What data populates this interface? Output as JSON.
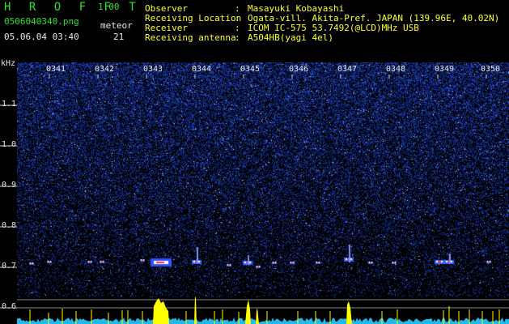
{
  "header": {
    "app_name": "H R O F F T",
    "version": "1.00",
    "filename": "0506040340.png",
    "datetime": "05.06.04 03:40",
    "meteor_label": "meteor",
    "meteor_count": "21"
  },
  "info": [
    {
      "label": "Observer",
      "value": "Masayuki Kobayashi"
    },
    {
      "label": "Receiving Location",
      "value": "Ogata-vill. Akita-Pref. JAPAN (139.96E, 40.02N)"
    },
    {
      "label": "Receiver",
      "value": "ICOM IC-575 53.7492(@LCD)MHz USB"
    },
    {
      "label": "Receiving antenna",
      "value": "A504HB(yagi 4el)"
    }
  ],
  "separator": ":",
  "axis": {
    "y_unit": "kHz",
    "y_ticks": [
      "1.1",
      "1.0",
      "0.9",
      "0.8",
      "0.7",
      "0.6"
    ],
    "x_ticks": [
      "0341",
      "0342",
      "0343",
      "0344",
      "0345",
      "0346",
      "0347",
      "0348",
      "0349",
      "0350"
    ]
  },
  "colors": {
    "title": "#2be02b",
    "info_text": "#ffff33",
    "signal_profile": "#ffff00",
    "noise_floor": "#33ccff",
    "background_noise": "#1a2a9a"
  }
}
